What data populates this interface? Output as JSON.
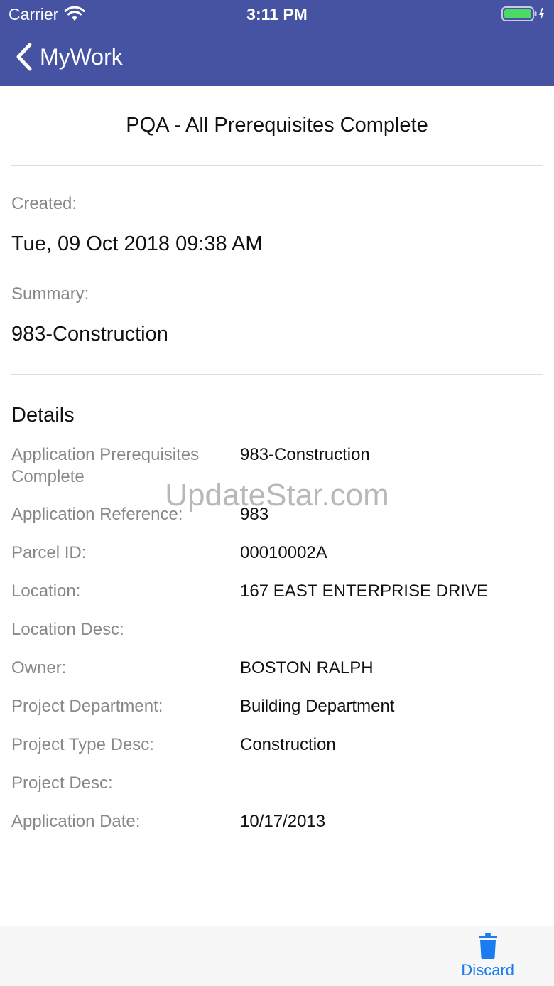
{
  "status_bar": {
    "carrier": "Carrier",
    "time": "3:11 PM"
  },
  "nav": {
    "back_label": "MyWork",
    "back_icon": "chevron-left-icon",
    "bar_color": "#4652a2"
  },
  "page": {
    "title": "PQA - All Prerequisites Complete",
    "created_label": "Created:",
    "created_value": "Tue, 09 Oct 2018 09:38 AM",
    "summary_label": "Summary:",
    "summary_value": "983-Construction",
    "details_heading": "Details"
  },
  "details": [
    {
      "label": "Application Prerequisites Complete",
      "value": "983-Construction"
    },
    {
      "label": "Application Reference:",
      "value": "983"
    },
    {
      "label": "Parcel ID:",
      "value": "00010002A"
    },
    {
      "label": "Location:",
      "value": "167 EAST ENTERPRISE DRIVE"
    },
    {
      "label": "Location Desc:",
      "value": ""
    },
    {
      "label": "Owner:",
      "value": "BOSTON RALPH"
    },
    {
      "label": "Project Department:",
      "value": "Building Department"
    },
    {
      "label": "Project Type Desc:",
      "value": "Construction"
    },
    {
      "label": "Project Desc:",
      "value": ""
    },
    {
      "label": "Application Date:",
      "value": "10/17/2013"
    }
  ],
  "watermark": "UpdateStar.com",
  "toolbar": {
    "discard_label": "Discard",
    "discard_icon": "trash-icon",
    "accent_color": "#1a7cf0"
  }
}
